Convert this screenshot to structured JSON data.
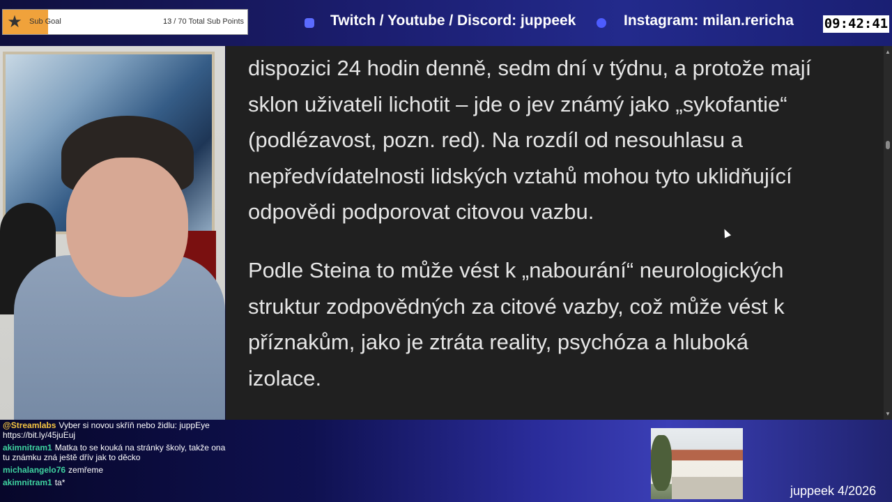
{
  "sub_goal": {
    "label": "Sub Goal",
    "current": "13",
    "total_text": "/ 70 Total Sub Points",
    "progress_fraction": 0.186,
    "fill_color": "#f0a23b",
    "icon": "star-icon"
  },
  "social": {
    "twitch_text": "Twitch / Youtube / Discord: juppeek",
    "twitch_icon": "twitch-icon",
    "instagram_text": "Instagram: milan.rericha",
    "instagram_icon": "instagram-icon"
  },
  "clock": "09:42:41",
  "article": {
    "paragraph_1_lines": [
      "dispozici 24 hodin denně, sedm dní v týdnu, a protože mají",
      "sklon uživateli lichotit – jde o jev známý jako „sykofantie“",
      "(podlézavost, pozn. red). Na rozdíl od nesouhlasu a",
      "nepředvídatelnosti lidských vztahů mohou tyto uklidňující",
      "odpovědi podporovat citovou vazbu."
    ],
    "paragraph_2_lines": [
      "Podle Steina to může vést k „nabourání“ neurologických",
      "struktur zodpovědných za citové vazby, což může vést k",
      "příznakům, jako je ztráta reality, psychóza a hluboká",
      "izolace."
    ]
  },
  "chat": [
    {
      "user": "@Streamlabs",
      "user_color": "#f5c542",
      "text": "Vyber si novou skříň nebo židlu: juppEye https://bit.ly/45juEuj"
    },
    {
      "user": "akimnitram1",
      "user_color": "#3fd4a0",
      "text": "Matka to se kouká na stránky školy, takže ona tu známku zná ještě dřív jak to děcko"
    },
    {
      "user": "michalangelo76",
      "user_color": "#3fd4a0",
      "text": "zemřeme"
    },
    {
      "user": "akimnitram1",
      "user_color": "#3fd4a0",
      "text": "ta*"
    }
  ],
  "watermark": "juppeek 4/2026"
}
